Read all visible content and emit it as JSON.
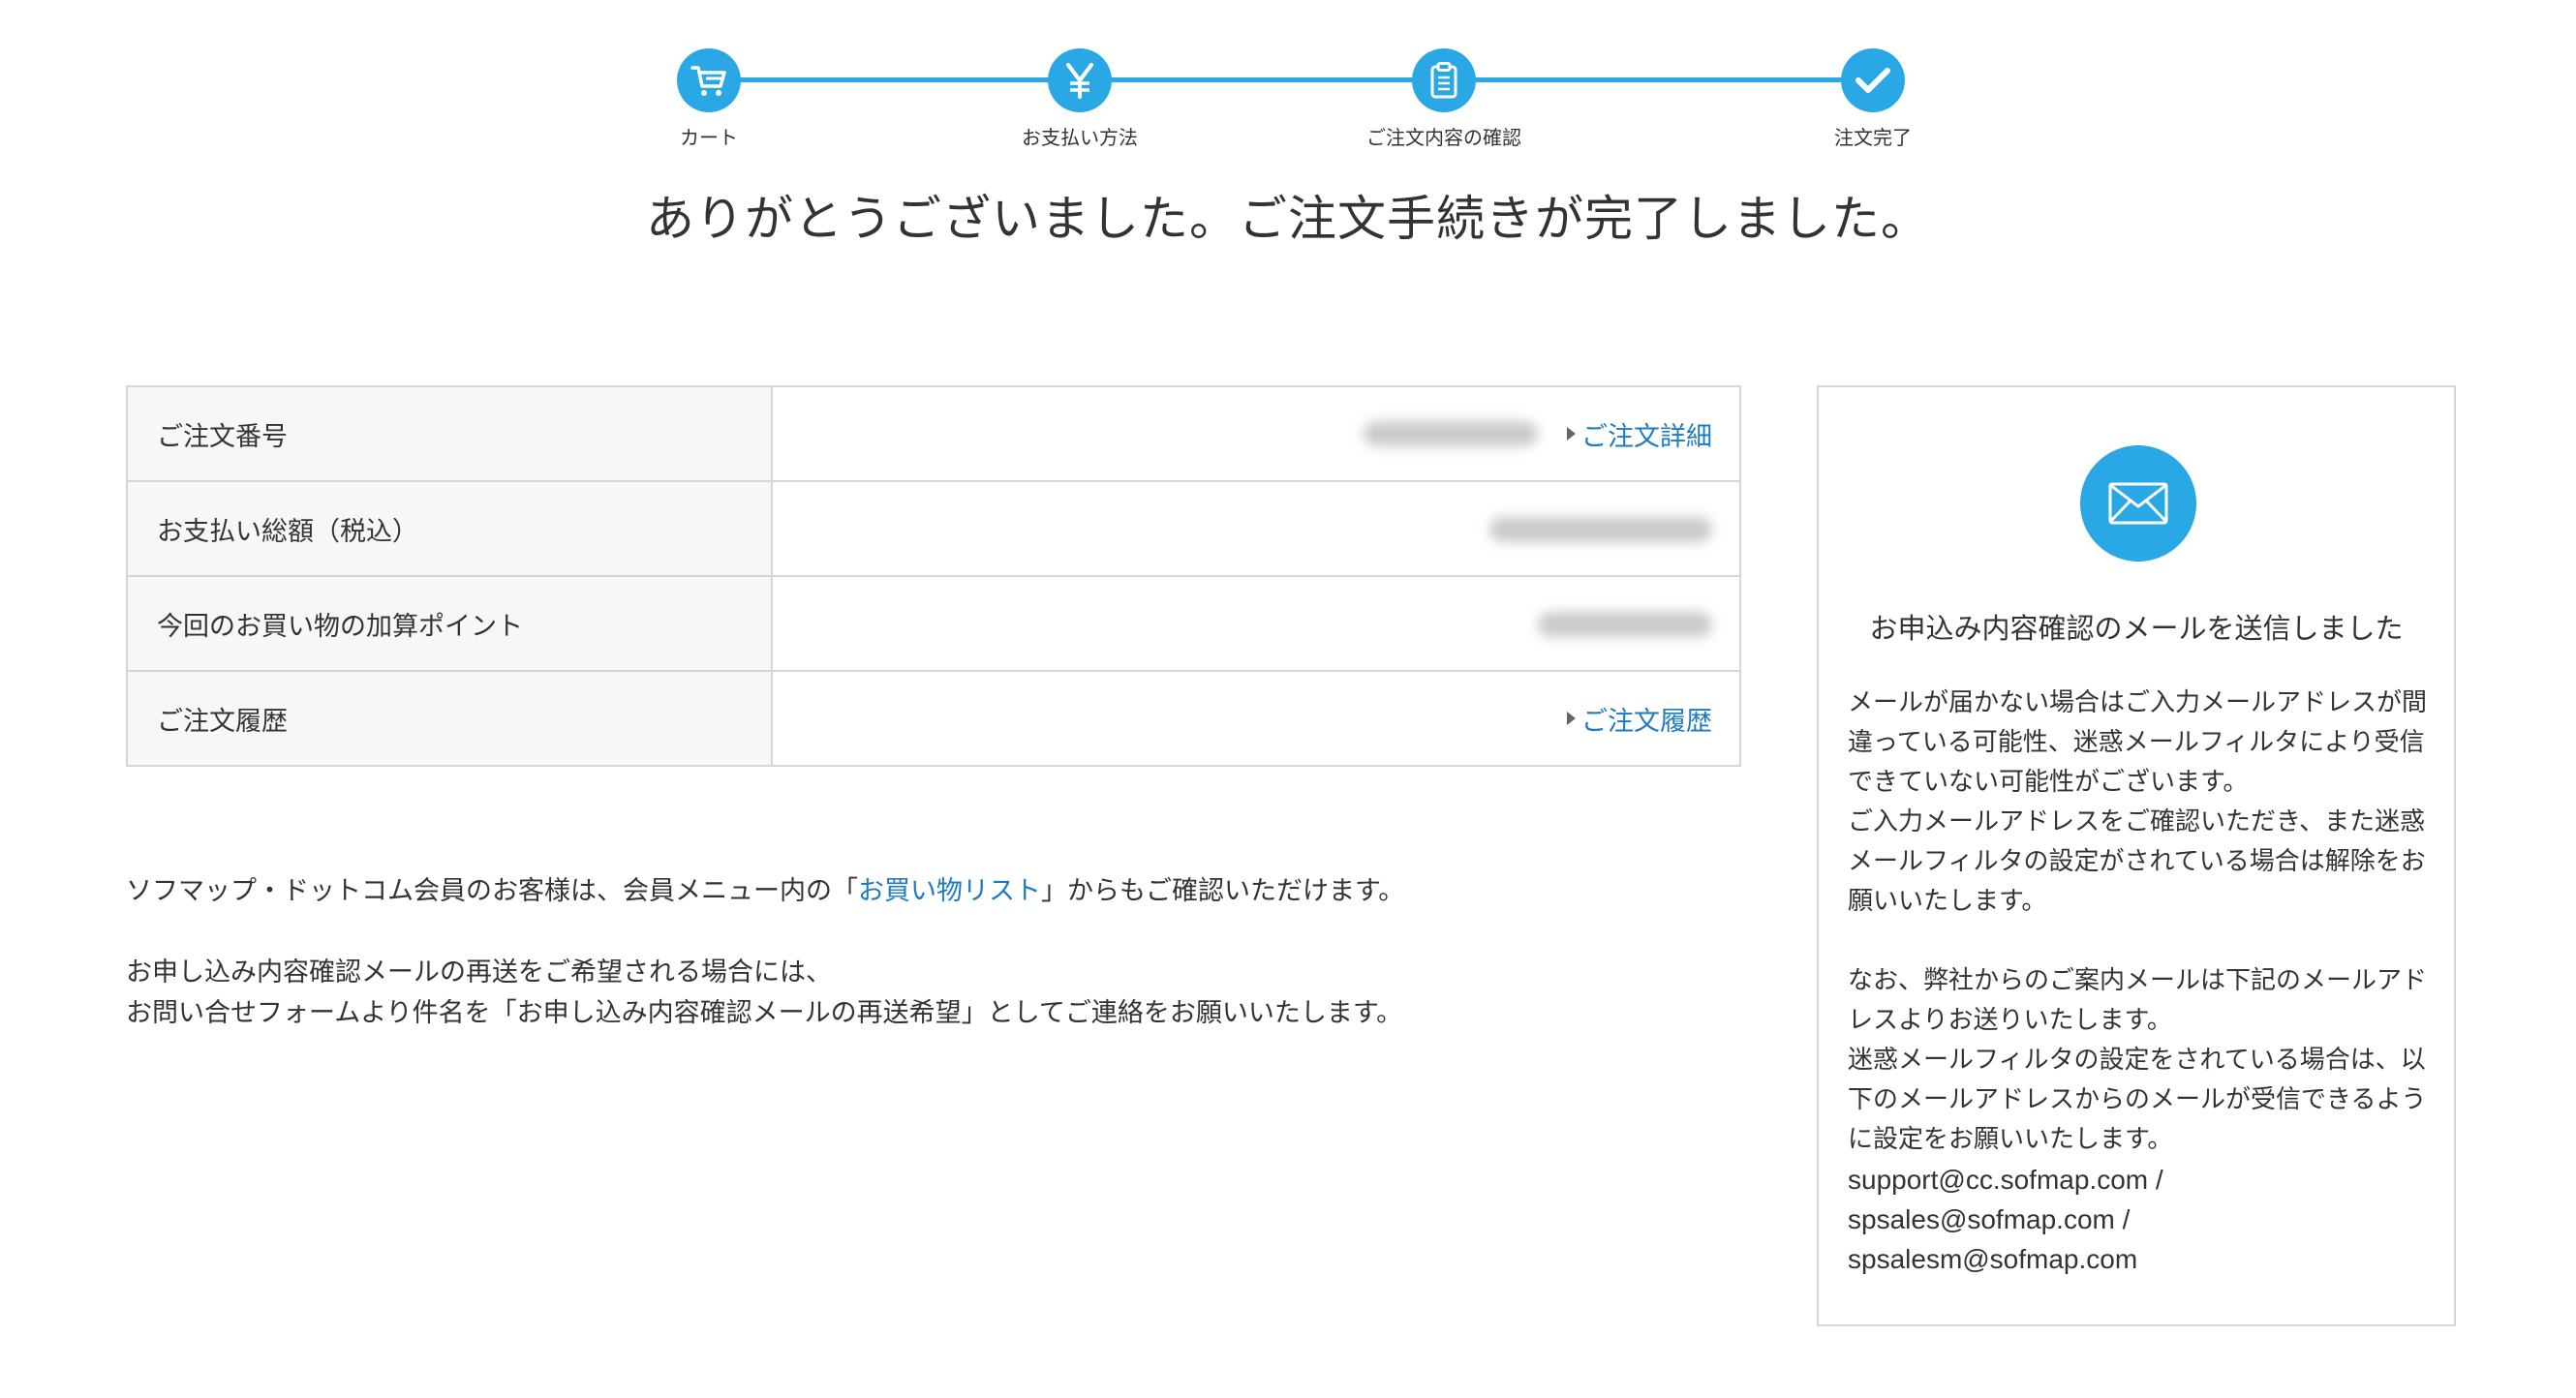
{
  "colors": {
    "accent": "#2aa8e6",
    "link": "#1c7bc4",
    "border": "#d6d6d6",
    "header_bg": "#f7f7f7"
  },
  "stepper": {
    "steps": [
      {
        "label": "カート",
        "icon": "cart-icon"
      },
      {
        "label": "お支払い方法",
        "icon": "yen-icon"
      },
      {
        "label": "ご注文内容の確認",
        "icon": "clipboard-icon"
      },
      {
        "label": "注文完了",
        "icon": "check-icon"
      }
    ]
  },
  "heading": "ありがとうございました。ご注文手続きが完了しました。",
  "order_table": {
    "rows": [
      {
        "label": "ご注文番号",
        "link": "ご注文詳細"
      },
      {
        "label": "お支払い総額（税込）"
      },
      {
        "label": "今回のお買い物の加算ポイント"
      },
      {
        "label": "ご注文履歴",
        "link": "ご注文履歴"
      }
    ]
  },
  "notes": {
    "line1_before": "ソフマップ・ドットコム会員のお客様は、会員メニュー内の「",
    "line1_link": "お買い物リスト",
    "line1_after": "」からもご確認いただけます。",
    "line2": "お申し込み内容確認メールの再送をご希望される場合には、",
    "line3": "お問い合せフォームより件名を「お申し込み内容確認メールの再送希望」としてご連絡をお願いいたします。"
  },
  "mail_box": {
    "title": "お申込み内容確認のメールを送信しました",
    "p1": "メールが届かない場合はご入力メールアドレスが間違っている可能性、迷惑メールフィルタにより受信できていない可能性がございます。",
    "p2": "ご入力メールアドレスをご確認いただき、また迷惑メールフィルタの設定がされている場合は解除をお願いいたします。",
    "p3": "なお、弊社からのご案内メールは下記のメールアドレスよりお送りいたします。",
    "p4": "迷惑メールフィルタの設定をされている場合は、以下のメールアドレスからのメールが受信できるように設定をお願いいたします。",
    "addresses": [
      "support@cc.sofmap.com /",
      "spsales@sofmap.com /",
      "spsalesm@sofmap.com"
    ]
  }
}
